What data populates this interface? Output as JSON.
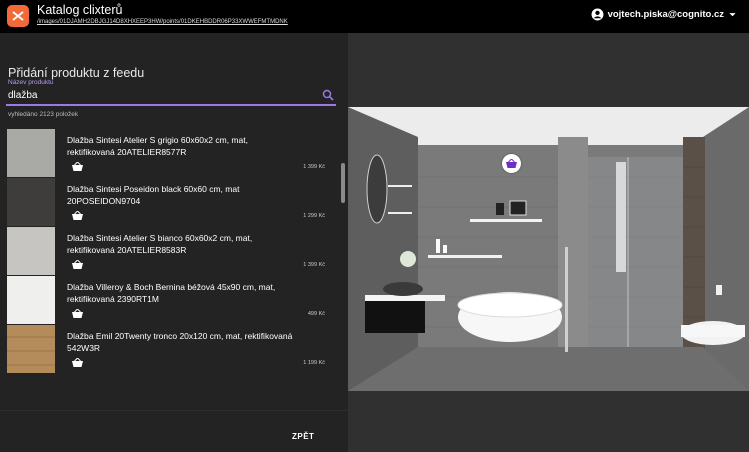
{
  "header": {
    "app_title": "Katalog clixterů",
    "path": "/images/01DJAMH2DBJGJ14D8XHXEEP3HW/points/01DKEHBDDR06P33XWWEFMTMDNK",
    "user_email": "vojtech.piska@cognito.cz"
  },
  "panel": {
    "title": "Přidání produktu z feedu",
    "search": {
      "label": "Název produktu",
      "value": "dlažba"
    },
    "result_count": "vyhledáno 2123 položek",
    "items": [
      {
        "name": "Dlažba Sintesi Atelier S grigio 60x60x2 cm, mat, rektifikovaná 20ATELIER8577R",
        "price": "1 399 Kč",
        "thumb_color": "#a9a9a6"
      },
      {
        "name": "Dlažba Sintesi Poseidon black 60x60 cm, mat 20POSEIDON9704",
        "price": "1 299 Kč",
        "thumb_color": "#3e3d3b"
      },
      {
        "name": "Dlažba Sintesi Atelier S bianco 60x60x2 cm, mat, rektifikovaná 20ATELIER8583R",
        "price": "1 399 Kč",
        "thumb_color": "#c7c5c1"
      },
      {
        "name": "Dlažba Villeroy & Boch Bernina béžová 45x90 cm, mat, rektifikovaná 2390RT1M",
        "price": "499 Kč",
        "thumb_color": "#efefed"
      },
      {
        "name": "Dlažba Emil 20Twenty tronco 20x120 cm, mat, rektifikovaná 542W3R",
        "price": "1 199 Kč",
        "thumb_color": "#b48c5c"
      }
    ],
    "back_label": "ZPĚT"
  },
  "colors": {
    "accent": "#9a78e6",
    "logo": "#f06a3a",
    "hotspot_icon": "#6f2fc4"
  }
}
